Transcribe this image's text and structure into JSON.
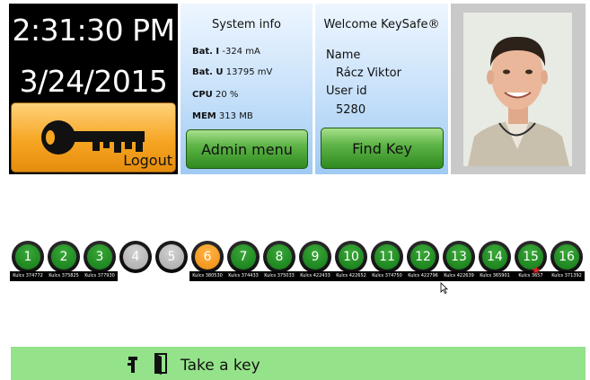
{
  "clock": {
    "time": "2:31:30 PM",
    "date": "3/24/2015"
  },
  "logout": {
    "label": "Logout"
  },
  "system_info": {
    "title": "System info",
    "rows": [
      {
        "key": "Bat. I",
        "value": "-324 mA"
      },
      {
        "key": "Bat. U",
        "value": "13795 mV"
      },
      {
        "key": "CPU",
        "value": "20 %"
      },
      {
        "key": "MEM",
        "value": "313 MB"
      }
    ],
    "admin_button": "Admin menu"
  },
  "welcome": {
    "title": "Welcome KeySafe®",
    "name_label": "Name",
    "name_value": "Rácz Viktor",
    "userid_label": "User id",
    "userid_value": "5280",
    "find_button": "Find Key"
  },
  "slots": [
    {
      "number": "1",
      "state": "green",
      "label": "Kulcs 374772"
    },
    {
      "number": "2",
      "state": "green",
      "label": "Kulcs 375825"
    },
    {
      "number": "3",
      "state": "green",
      "label": "Kulcs 377930"
    },
    {
      "number": "4",
      "state": "empty",
      "label": ""
    },
    {
      "number": "5",
      "state": "empty",
      "label": ""
    },
    {
      "number": "6",
      "state": "orange",
      "label": "Kulcs 380530"
    },
    {
      "number": "7",
      "state": "green",
      "label": "Kulcs 374433"
    },
    {
      "number": "8",
      "state": "green",
      "label": "Kulcs 375033"
    },
    {
      "number": "9",
      "state": "green",
      "label": "Kulcs 422433"
    },
    {
      "number": "10",
      "state": "green",
      "label": "Kulcs 422652"
    },
    {
      "number": "11",
      "state": "green",
      "label": "Kulcs 374750"
    },
    {
      "number": "12",
      "state": "green",
      "label": "Kulcs 422796"
    },
    {
      "number": "13",
      "state": "green",
      "label": "Kulcs 422639"
    },
    {
      "number": "14",
      "state": "green",
      "label": "Kulcs 365901"
    },
    {
      "number": "15",
      "state": "green",
      "label": "Kulcs 3657",
      "warning": true
    },
    {
      "number": "16",
      "state": "green",
      "label": "Kulcs 371392"
    }
  ],
  "bottom_bar": {
    "label": "Take a key"
  },
  "colors": {
    "accent_green": "#2f8a1f",
    "orange": "#f08c10",
    "panel_blue": "#9fcaf2",
    "bottom_bar": "#94e38a"
  }
}
